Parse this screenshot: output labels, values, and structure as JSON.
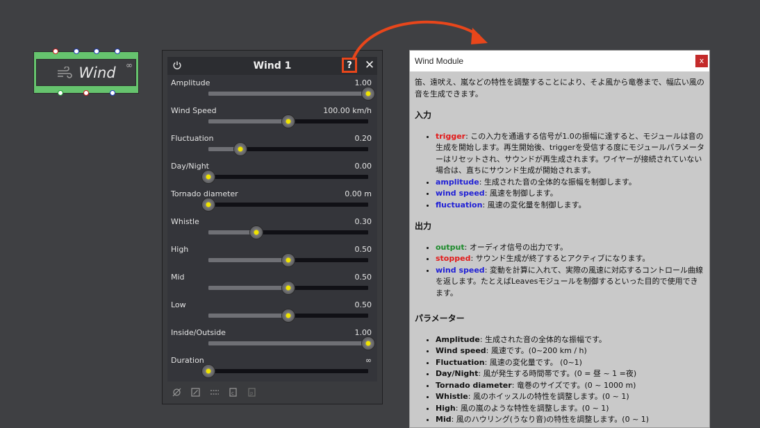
{
  "node": {
    "title": "Wind",
    "infinity": "∞"
  },
  "panel": {
    "title": "Wind 1",
    "help_label": "?",
    "close_label": "✕",
    "params": [
      {
        "name": "Amplitude",
        "value": "1.00",
        "level": 1.0
      },
      {
        "name": "Wind Speed",
        "value": "100.00 km/h",
        "level": 0.5
      },
      {
        "name": "Fluctuation",
        "value": "0.20",
        "level": 0.2
      },
      {
        "name": "Day/Night",
        "value": "0.00",
        "level": 0.0
      },
      {
        "name": "Tornado diameter",
        "value": "0.00 m",
        "level": 0.0
      },
      {
        "name": "Whistle",
        "value": "0.30",
        "level": 0.3
      },
      {
        "name": "High",
        "value": "0.50",
        "level": 0.5
      },
      {
        "name": "Mid",
        "value": "0.50",
        "level": 0.5
      },
      {
        "name": "Low",
        "value": "0.50",
        "level": 0.5
      },
      {
        "name": "Inside/Outside",
        "value": "1.00",
        "level": 1.0
      },
      {
        "name": "Duration",
        "value": "∞",
        "level": 0.0
      }
    ]
  },
  "help": {
    "title": "Wind Module",
    "close_label": "x",
    "intro": "笛、遠吠え、嵐などの特性を調整することにより、そよ風から竜巻まで、幅広い風の音を生成できます。",
    "input_heading": "入力",
    "inputs": [
      {
        "name": "trigger",
        "desc": ": この入力を通過する信号が1.0の振幅に達すると、モジュールは音の生成を開始します。再生開始後、triggerを受信する度にモジュールパラメーターはリセットされ、サウンドが再生成されます。ワイヤーが接続されていない場合は、直ちにサウンド生成が開始されます。"
      },
      {
        "name": "amplitude",
        "desc": ": 生成された音の全体的な振幅を制御します。"
      },
      {
        "name": "wind speed",
        "desc": ": 風速を制御します。"
      },
      {
        "name": "fluctuation",
        "desc": ": 風速の変化量を制御します。"
      }
    ],
    "output_heading": "出力",
    "outputs": [
      {
        "name": "output",
        "desc": ": オーディオ信号の出力です。"
      },
      {
        "name": "stopped",
        "desc": ": サウンド生成が終了するとアクティブになります。"
      },
      {
        "name": "wind speed",
        "desc": ": 変動を計算に入れて、実際の風速に対応するコントロール曲線を返します。たとえばLeavesモジュールを制御するといった目的で使用できます。"
      }
    ],
    "param_heading": "パラメーター",
    "parameters": [
      {
        "name": "Amplitude",
        "desc": ": 生成された音の全体的な振幅です。"
      },
      {
        "name": "Wind speed",
        "desc": ": 風速です。(0~200 km / h)"
      },
      {
        "name": "Fluctuation",
        "desc": ": 風速の変化量です。 (0~1)"
      },
      {
        "name": "Day/Night",
        "desc": ": 風が発生する時間帯です。(0 = 昼 ~ 1 =夜)"
      },
      {
        "name": "Tornado diameter",
        "desc": ": 竜巻のサイズです。(0 ~ 1000 m)"
      },
      {
        "name": "Whistle",
        "desc": ": 風のホイッスルの特性を調整します。(0 ~ 1)"
      },
      {
        "name": "High",
        "desc": ": 風の嵐のような特性を調整します。(0 ~ 1)"
      },
      {
        "name": "Mid",
        "desc": ": 風のハウリング(うなり音)の特性を調整します。(0 ~ 1)"
      }
    ]
  },
  "colors": {
    "accent_orange": "#e8461b",
    "node_green": "#66c46e",
    "knob_yellow": "#f0e400"
  }
}
